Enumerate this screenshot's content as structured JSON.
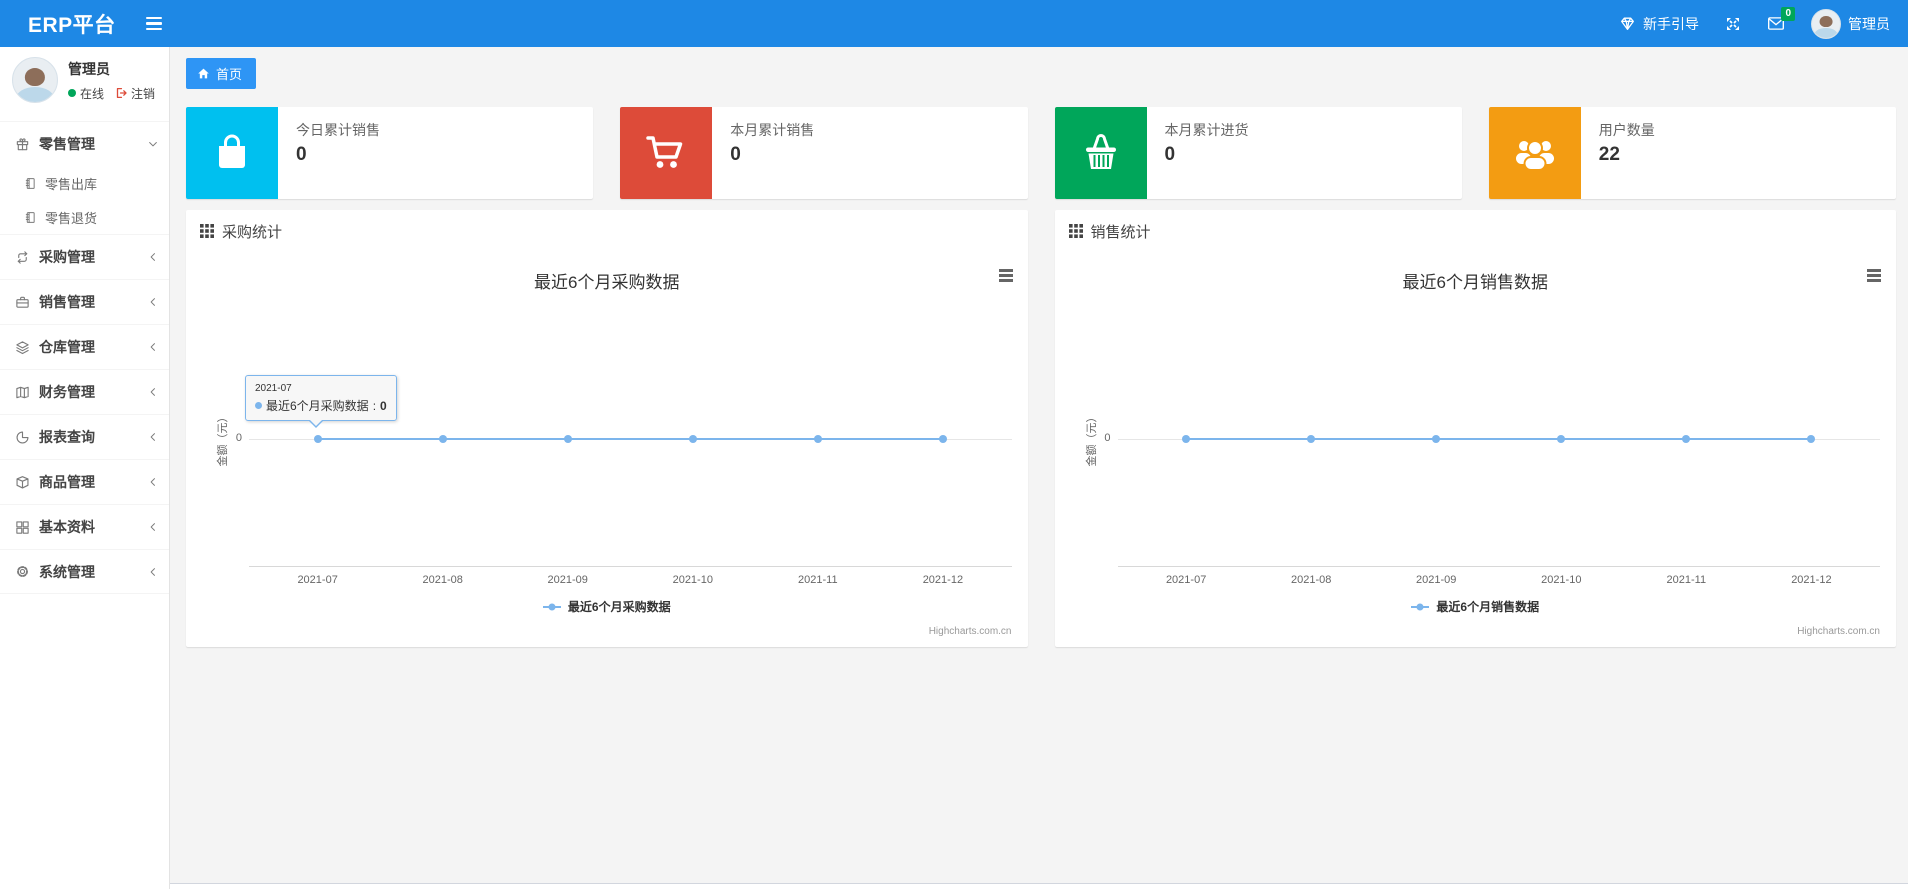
{
  "navbar": {
    "brand": "ERP平台",
    "guide_label": "新手引导",
    "messages_badge": "0",
    "user_name": "管理员"
  },
  "sidebar": {
    "user": {
      "name": "管理员",
      "status": "在线",
      "logout_label": "注销"
    },
    "items": [
      {
        "label": "零售管理",
        "expanded": true,
        "children": [
          {
            "label": "零售出库"
          },
          {
            "label": "零售退货"
          }
        ]
      },
      {
        "label": "采购管理"
      },
      {
        "label": "销售管理"
      },
      {
        "label": "仓库管理"
      },
      {
        "label": "财务管理"
      },
      {
        "label": "报表查询"
      },
      {
        "label": "商品管理"
      },
      {
        "label": "基本资料"
      },
      {
        "label": "系统管理"
      }
    ]
  },
  "breadcrumb": {
    "home_label": "首页"
  },
  "stat_cards": [
    {
      "label": "今日累计销售",
      "value": "0",
      "color": "#00c0ef",
      "icon": "shopping-bag-icon"
    },
    {
      "label": "本月累计销售",
      "value": "0",
      "color": "#dd4b39",
      "icon": "shopping-cart-icon"
    },
    {
      "label": "本月累计进货",
      "value": "0",
      "color": "#00a65a",
      "icon": "shopping-basket-icon"
    },
    {
      "label": "用户数量",
      "value": "22",
      "color": "#f39c12",
      "icon": "users-icon"
    }
  ],
  "panels": [
    {
      "header": "采购统计"
    },
    {
      "header": "销售统计"
    }
  ],
  "chart_data": [
    {
      "type": "line",
      "title": "最近6个月采购数据",
      "ylabel": "金额（元）",
      "categories": [
        "2021-07",
        "2021-08",
        "2021-09",
        "2021-10",
        "2021-11",
        "2021-12"
      ],
      "series": [
        {
          "name": "最近6个月采购数据",
          "values": [
            0,
            0,
            0,
            0,
            0,
            0
          ]
        }
      ],
      "yticks": [
        "0"
      ],
      "ylim": [
        0,
        1
      ],
      "grid": false,
      "legend_position": "bottom",
      "line_color": "#7cb5ec",
      "credits": "Highcharts.com.cn",
      "tooltip": {
        "category": "2021-07",
        "series": "最近6个月采购数据",
        "separator": ": ",
        "value": "0"
      }
    },
    {
      "type": "line",
      "title": "最近6个月销售数据",
      "ylabel": "金额（元）",
      "categories": [
        "2021-07",
        "2021-08",
        "2021-09",
        "2021-10",
        "2021-11",
        "2021-12"
      ],
      "series": [
        {
          "name": "最近6个月销售数据",
          "values": [
            0,
            0,
            0,
            0,
            0,
            0
          ]
        }
      ],
      "yticks": [
        "0"
      ],
      "ylim": [
        0,
        1
      ],
      "grid": false,
      "legend_position": "bottom",
      "line_color": "#7cb5ec",
      "credits": "Highcharts.com.cn"
    }
  ]
}
